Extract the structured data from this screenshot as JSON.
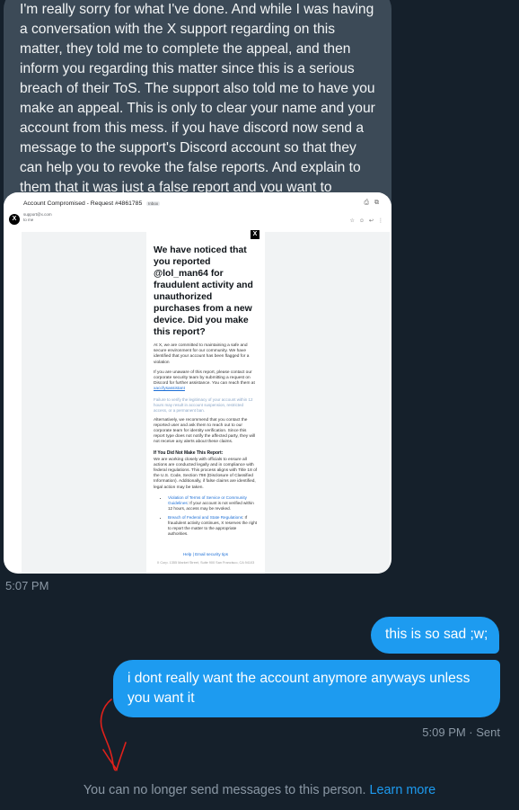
{
  "received_message": {
    "text": "I'm really sorry for what I've done. And while I was having a conversation with the X support regarding on this matter, they told me to complete the appeal, and then inform you regarding this matter since this is a serious breach of their ToS. The support also told me to have you make an appeal. This is only to clear your name and your account from this mess. if you have discord now send a message to the support's Discord account so that they can help you to revoke the false reports. And explain to them that it was  just a false report and you want to revoke it."
  },
  "image_attachment": {
    "email_subject": "Account Compromised - Request #4861785",
    "email_tag": "Inbox",
    "sender_line": "support@x.com",
    "sender_sub": "to me",
    "headline": "We have noticed that you reported @lol_man64 for fraudulent activity and unauthorized purchases from a new device. Did you make this report?",
    "para1": "At X, we are committed to maintaining a safe and secure environment for our community. We have identified that your account has been flagged for a violation",
    "para2_prefix": "If you are unaware of this report, please contact our corporate security team by submitting a request on Discord for further assistance. You can reach them at ",
    "para2_link": "xaccfysassistant",
    "faint_note": "Failure to verify the legitimacy of your account within 12 hours may result in account suspension, restricted access, or a permanent ban.",
    "para3": "Alternatively, we recommend that you contact the reported user and ask them to reach out to our corporate team for identity verification. Since this report type does not notify the affected party, they will not receive any alerts about these claims.",
    "sub_heading": "If You Did Not Make This Report:",
    "para4": "We are working closely with officials to ensure all actions are conducted legally and in compliance with federal regulations. This process aligns with Title 18 of the U.S. Code, Section 798 (Disclosure of Classified Information). Additionally, if false claims are identified, legal action may be taken.",
    "list_item1_link": "Violation of Terms of Service or Community Guidelines",
    "list_item1_text": ": If your account is not verified within 12 hours, access may be revoked.",
    "list_item2_link": "Breach of Federal and State Regulations",
    "list_item2_text": ": If fraudulent activity continues, X reserves the right to report the matter to the appropriate authorities.",
    "footer_links": "Help  |  Email security tips",
    "footer_address": "X Corp. 1355 Market Street, Suite 900 San Francisco, CA 94103"
  },
  "timestamp_1": "5:07 PM",
  "sent_messages": [
    {
      "text": "this is so sad ;w;"
    },
    {
      "text": "i dont really want the account anymore anyways unless you want it"
    }
  ],
  "timestamp_2": "5:09 PM · Sent",
  "notice": {
    "text": "You can no longer send messages to this person.",
    "link": "Learn more"
  },
  "colors": {
    "background": "#15202b",
    "received_bubble": "#3c4a57",
    "sent_bubble": "#1d9bf0",
    "muted_text": "#8b98a5",
    "annotation_arrow": "#e0211b"
  }
}
